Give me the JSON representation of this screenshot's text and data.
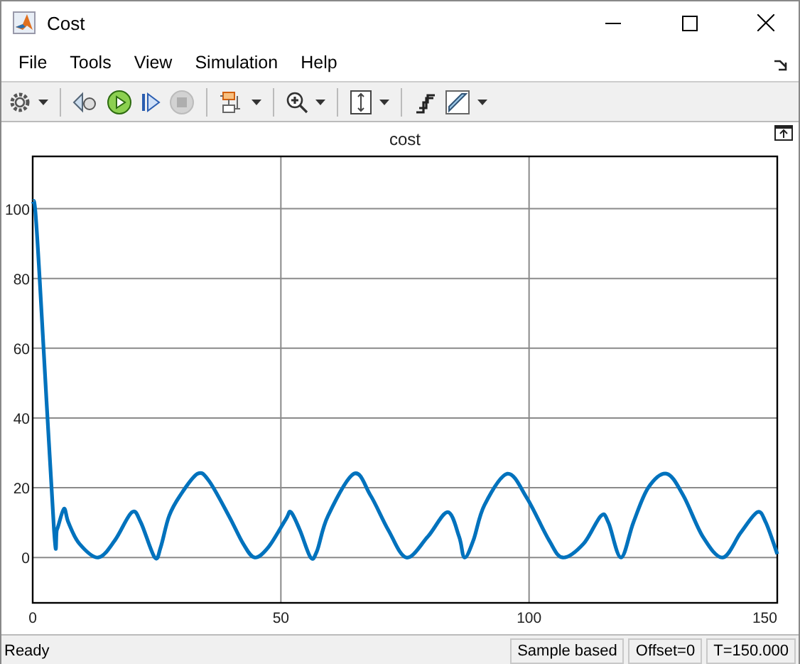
{
  "window": {
    "title": "Cost"
  },
  "menu": [
    "File",
    "Tools",
    "View",
    "Simulation",
    "Help"
  ],
  "toolbar": [
    {
      "buttons": [
        {
          "kind": "settings",
          "disabled": false,
          "dropdown": true
        }
      ]
    },
    {
      "buttons": [
        {
          "kind": "step-back",
          "disabled": false,
          "dropdown": false
        },
        {
          "kind": "run",
          "disabled": false,
          "dropdown": false
        },
        {
          "kind": "step-forward",
          "disabled": false,
          "dropdown": false
        },
        {
          "kind": "stop",
          "disabled": true,
          "dropdown": false
        }
      ]
    },
    {
      "buttons": [
        {
          "kind": "highlight",
          "disabled": false,
          "dropdown": true
        }
      ]
    },
    {
      "buttons": [
        {
          "kind": "zoom",
          "disabled": false,
          "dropdown": true
        }
      ]
    },
    {
      "buttons": [
        {
          "kind": "scale",
          "disabled": false,
          "dropdown": true
        }
      ]
    },
    {
      "buttons": [
        {
          "kind": "triggers",
          "disabled": false,
          "dropdown": false
        },
        {
          "kind": "measure",
          "disabled": false,
          "dropdown": true
        }
      ]
    }
  ],
  "plot": {
    "chart_data": {
      "type": "line",
      "title": "cost",
      "grid": true,
      "xlim": [
        0,
        150
      ],
      "ylim": [
        -13,
        115
      ],
      "xticks": [
        0,
        50,
        100,
        150
      ],
      "yticks": [
        0,
        20,
        40,
        60,
        80,
        100
      ],
      "x": [
        0,
        0.5,
        1.4,
        4.3,
        4.9,
        6.3,
        7.2,
        9.4,
        13.2,
        16.6,
        20,
        21.8,
        24.6,
        25.8,
        27.5,
        29.8,
        33.2,
        35.5,
        39.5,
        42.4,
        44.7,
        47.5,
        51,
        52,
        53.8,
        56,
        57.3,
        59.5,
        64.7,
        68,
        71.6,
        75.3,
        79.6,
        83.6,
        85.9,
        87,
        88.8,
        91,
        95.6,
        99.6,
        104,
        106.8,
        111,
        114.5,
        116,
        118.5,
        121,
        124,
        127.7,
        131,
        135,
        139,
        142.6,
        146,
        147.7,
        150
      ],
      "series": [
        {
          "color": "#0072bd",
          "values": [
            102,
            100,
            80,
            8,
            8,
            14,
            10,
            4,
            0,
            5,
            13,
            10,
            0,
            3,
            12,
            18,
            24,
            22,
            12,
            4,
            0,
            3,
            11,
            13,
            8,
            0,
            2,
            12,
            24,
            18,
            8,
            0,
            6,
            13,
            6,
            0,
            5,
            15,
            24,
            17,
            5,
            0,
            4,
            12,
            10,
            0,
            10,
            20,
            24,
            18,
            6,
            0,
            7,
            13,
            10,
            1
          ]
        }
      ]
    }
  },
  "status": {
    "text": "Ready",
    "fields": [
      "Sample based",
      "Offset=0",
      "T=150.000"
    ]
  }
}
